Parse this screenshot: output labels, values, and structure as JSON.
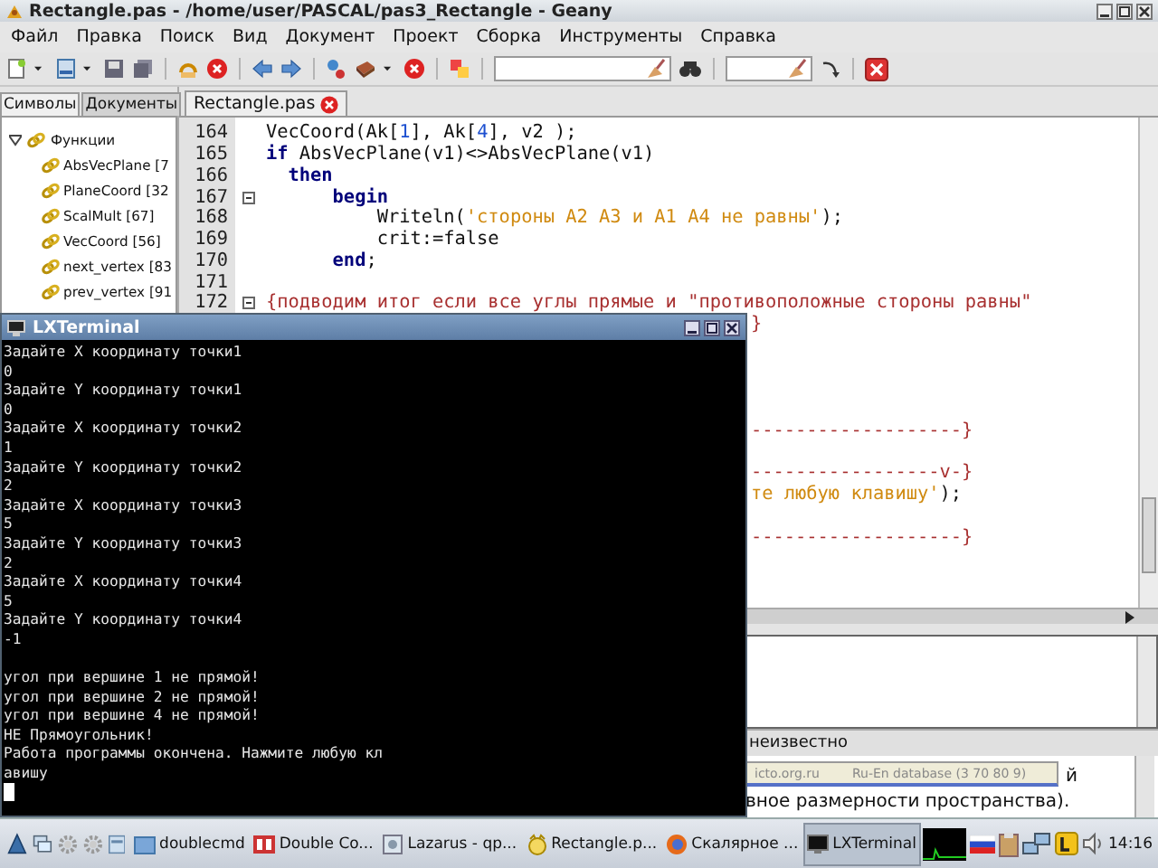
{
  "window": {
    "title": "Rectangle.pas - /home/user/PASCAL/pas3_Rectangle - Geany"
  },
  "menu": [
    "Файл",
    "Правка",
    "Поиск",
    "Вид",
    "Документ",
    "Проект",
    "Сборка",
    "Инструменты",
    "Справка"
  ],
  "sidebar": {
    "tabs": [
      {
        "label": "Символы",
        "selected": true
      },
      {
        "label": "Документы",
        "selected": false
      }
    ],
    "tree": [
      {
        "label": "Функции",
        "expanded": true,
        "children": [
          {
            "label": "AbsVecPlane [7"
          },
          {
            "label": "PlaneCoord [32"
          },
          {
            "label": "ScalMult [67]"
          },
          {
            "label": "VecCoord [56]"
          },
          {
            "label": "next_vertex [83"
          },
          {
            "label": "prev_vertex [91"
          }
        ]
      }
    ]
  },
  "editor": {
    "tabs": [
      {
        "label": "Rectangle.pas",
        "selected": true
      }
    ],
    "lines": [
      {
        "number": "164",
        "fold": false,
        "segments": [
          {
            "text": "VecCoord(Ak[",
            "kind": "plain"
          },
          {
            "text": "1",
            "kind": "number"
          },
          {
            "text": "], Ak[",
            "kind": "plain"
          },
          {
            "text": "4",
            "kind": "number"
          },
          {
            "text": "], v2 );",
            "kind": "plain"
          }
        ]
      },
      {
        "number": "165",
        "fold": false,
        "segments": [
          {
            "text": "if",
            "kind": "keyword"
          },
          {
            "text": " AbsVecPlane(v1)<>AbsVecPlane(v1)",
            "kind": "plain"
          }
        ]
      },
      {
        "number": "166",
        "fold": false,
        "segments": [
          {
            "text": "  then",
            "kind": "keyword"
          }
        ]
      },
      {
        "number": "167",
        "fold": true,
        "segments": [
          {
            "text": "      begin",
            "kind": "keyword"
          }
        ]
      },
      {
        "number": "168",
        "fold": false,
        "segments": [
          {
            "text": "          Writeln(",
            "kind": "plain"
          },
          {
            "text": "'стороны A2 A3 и A1 A4 не равны'",
            "kind": "string"
          },
          {
            "text": ");",
            "kind": "plain"
          }
        ]
      },
      {
        "number": "169",
        "fold": false,
        "segments": [
          {
            "text": "          crit:=false",
            "kind": "plain"
          }
        ]
      },
      {
        "number": "170",
        "fold": false,
        "segments": [
          {
            "text": "      end",
            "kind": "keyword"
          },
          {
            "text": ";",
            "kind": "plain"
          }
        ]
      },
      {
        "number": "171",
        "fold": false
      },
      {
        "number": "172",
        "fold": true,
        "segments": [
          {
            "text": "{подводим итог если все углы прямые и \"противоположные стороны равны\"",
            "kind": "comment"
          }
        ]
      }
    ],
    "covered_lines": [
      {
        "segments": [
          {
            "text": "}",
            "kind": "comment"
          }
        ]
      },
      {
        "segments": [
          {
            "text": "-------------------}",
            "kind": "comment"
          }
        ]
      },
      {
        "segments": [
          {
            "text": "-----------------v-}",
            "kind": "comment"
          }
        ]
      },
      {
        "segments": [
          {
            "text": "те любую клавишу'",
            "kind": "string"
          },
          {
            "text": ");",
            "kind": "plain"
          }
        ]
      },
      {
        "segments": [
          {
            "text": "-------------------}",
            "kind": "comment"
          }
        ]
      }
    ]
  },
  "status_bar": {
    "text": "неизвестно"
  },
  "terminal": {
    "title": "LXTerminal",
    "blocks": [
      [
        "Задайте X координату точки1",
        "0",
        "Задайте Y координату точки1",
        "0",
        "Задайте X координату точки2",
        "1",
        "Задайте Y координату точки2",
        "2",
        "Задайте X координату точки3",
        "5",
        "Задайте Y координату точки3",
        "2",
        "Задайте X координату точки4",
        "5",
        "Задайте Y координату точки4",
        "-1"
      ],
      [
        "угол при вершине 1 не прямой!",
        "угол при вершине 2 не прямой!",
        "угол при вершине 4 не прямой!",
        "НЕ Прямоугольник!",
        "Работа программы окончена. Нажмите любую кл",
        "авишу"
      ]
    ]
  },
  "popup": {
    "cells": [
      "icto.org.ru",
      "Ru-En database (3 70 80 9)"
    ]
  },
  "background_window": {
    "lines": [
      "й",
      "вное размерности пространства)."
    ]
  },
  "taskbar": {
    "items": [
      {
        "label": "doublecmd",
        "selected": false
      },
      {
        "label": "Double Co...",
        "selected": false
      },
      {
        "label": "Lazarus - qp...",
        "selected": false
      },
      {
        "label": "Rectangle.p...",
        "selected": false
      },
      {
        "label": "Скалярное ...",
        "selected": false
      },
      {
        "label": "LXTerminal",
        "selected": true
      }
    ],
    "clock": "14:16"
  }
}
